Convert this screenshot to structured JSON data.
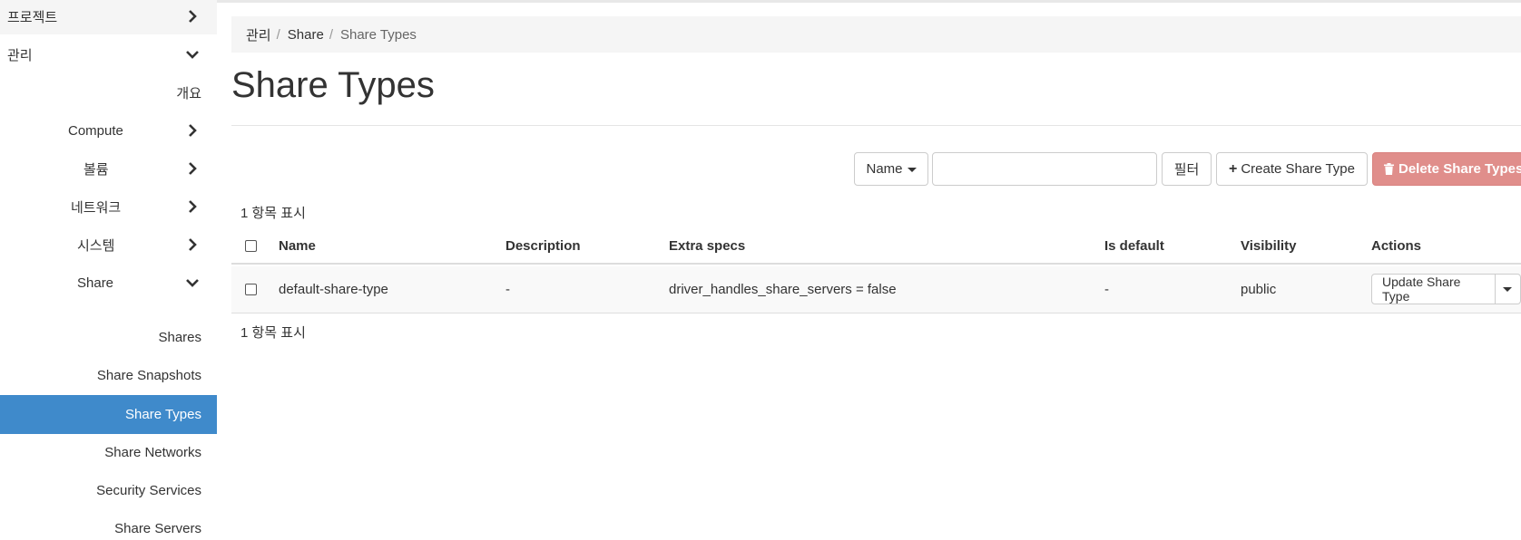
{
  "sidebar": {
    "project": "프로젝트",
    "admin": "관리",
    "overview": "개요",
    "compute": "Compute",
    "volumes": "볼륨",
    "network": "네트워크",
    "system": "시스템",
    "share": "Share",
    "shares": "Shares",
    "share_snapshots": "Share Snapshots",
    "share_types": "Share Types",
    "share_networks": "Share Networks",
    "security_services": "Security Services",
    "share_servers": "Share Servers"
  },
  "breadcrumb": [
    "관리",
    "Share",
    "Share Types"
  ],
  "breadcrumb_sep": "/",
  "page_title": "Share Types",
  "toolbar": {
    "filter_field": "Name",
    "filter_input_value": "",
    "filter_button": "필터",
    "create_button": "Create Share Type",
    "delete_button": "Delete Share Types"
  },
  "item_count_text": "1 항목 표시",
  "table": {
    "columns": [
      "Name",
      "Description",
      "Extra specs",
      "Is default",
      "Visibility",
      "Actions"
    ],
    "rows": [
      {
        "name": "default-share-type",
        "description": "-",
        "extra_specs": "driver_handles_share_servers = false",
        "is_default": "-",
        "visibility": "public",
        "action": "Update Share Type"
      }
    ]
  },
  "colors": {
    "active_nav": "#3f8acb",
    "danger_button": "#e08e8b"
  }
}
